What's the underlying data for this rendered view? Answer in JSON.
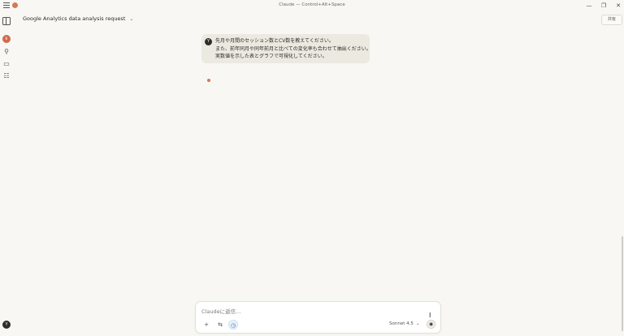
{
  "titlebar": {
    "title": "Claude — Control+Alt+Space",
    "min": "—",
    "max": "❐",
    "close": "✕"
  },
  "sidebar": {
    "avatar_initial": "k",
    "search_glyph": "⚲",
    "chats_glyph": "▭",
    "projects_glyph": "☷",
    "user_initial": "Y"
  },
  "header": {
    "conversation_title": "Google Analytics data analysis request",
    "chevron": "⌄",
    "share_label": "共有"
  },
  "message": {
    "avatar_initial": "Y",
    "lines": [
      "先月や月間のセッション数とCV数を教えてください。",
      "また、前年同月や同年前月と比べての変化率も合わせて抽出ください。",
      "実数値を示した表とグラフで可視化してください。"
    ]
  },
  "composer": {
    "placeholder": "Claudeに返信...",
    "plus": "+",
    "tools": "⇆",
    "research": "◷",
    "model": "Sonnet 4.5",
    "model_chevron": "⌄",
    "send": "◉",
    "cursor": "I"
  },
  "colors": {
    "accent": "#d77757",
    "background": "#f8f7f3",
    "message_bg": "#ece9e1"
  }
}
